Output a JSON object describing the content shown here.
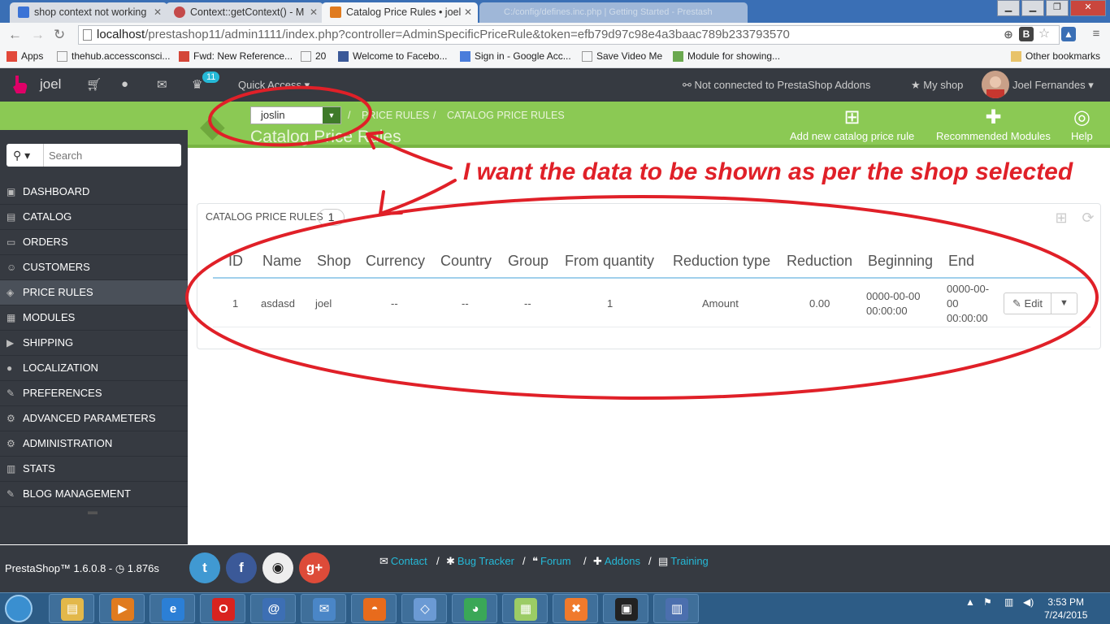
{
  "browser": {
    "tabs": [
      {
        "title": "shop context not working",
        "favicon_color": "#3b73d6",
        "active": false
      },
      {
        "title": "Context::getContext() - M",
        "favicon_color": "#c44a4a",
        "active": false
      },
      {
        "title": "Catalog Price Rules • joel",
        "favicon_color": "#e07b1f",
        "active": true
      }
    ],
    "ghost_tab": "C:/config/defines.inc.php | Getting Started - Prestash",
    "window_controls": {
      "minimize": "▁",
      "restore": "❐",
      "close": "✕"
    },
    "url_host": "localhost",
    "url_path": "/prestashop11/admin1111/index.php?controller=AdminSpecificPriceRule&token=efb79d97c98e4a3baac789b233793570",
    "bookmarks": [
      {
        "label": "Apps",
        "icon_color": "#e2483a"
      },
      {
        "label": "thehub.accessconsci...",
        "icon_color": "#ddd"
      },
      {
        "label": "Fwd: New Reference...",
        "icon_color": "#d44638"
      },
      {
        "label": "20",
        "icon_color": "#ddd"
      },
      {
        "label": "Welcome to Facebo...",
        "icon_color": "#3b5998"
      },
      {
        "label": "Sign in - Google Acc...",
        "icon_color": "#4a7ddb"
      },
      {
        "label": "Save Video Me",
        "icon_color": "#ddd"
      },
      {
        "label": "Module for showing...",
        "icon_color": "#6aa84f"
      }
    ],
    "other_bookmarks": "Other bookmarks"
  },
  "header": {
    "shop_name": "joel",
    "notification_count": "11",
    "quick_access": "Quick Access ▾",
    "addons_status": "Not connected to PrestaShop Addons",
    "my_shop": "My shop",
    "user_name": "Joel Fernandes ▾"
  },
  "toolbar": {
    "shop_selected": "joslin",
    "breadcrumb_1": "Price rules",
    "breadcrumb_2": "Catalog price rules",
    "page_title": "Catalog Price Rules",
    "add_new": "Add new catalog price rule",
    "recommended": "Recommended Modules",
    "help": "Help"
  },
  "sidebar": {
    "search_placeholder": "Search",
    "items": [
      {
        "label": "Dashboard",
        "icon": "▣"
      },
      {
        "label": "Catalog",
        "icon": "▤"
      },
      {
        "label": "Orders",
        "icon": "▭"
      },
      {
        "label": "Customers",
        "icon": "☺"
      },
      {
        "label": "Price Rules",
        "icon": "◈"
      },
      {
        "label": "Modules",
        "icon": "▦"
      },
      {
        "label": "Shipping",
        "icon": "▶"
      },
      {
        "label": "Localization",
        "icon": "●"
      },
      {
        "label": "Preferences",
        "icon": "✎"
      },
      {
        "label": "Advanced Parameters",
        "icon": "⚙"
      },
      {
        "label": "Administration",
        "icon": "⚙"
      },
      {
        "label": "Stats",
        "icon": "▥"
      },
      {
        "label": "Blog Management",
        "icon": "✎"
      }
    ],
    "active_index": 4
  },
  "panel": {
    "title": "Catalog price rules",
    "count": "1",
    "columns": [
      "ID",
      "Name",
      "Shop",
      "Currency",
      "Country",
      "Group",
      "From quantity",
      "Reduction type",
      "Reduction",
      "Beginning",
      "End"
    ],
    "rows": [
      {
        "id": "1",
        "name": "asdasd",
        "shop": "joel",
        "currency": "--",
        "country": "--",
        "group": "--",
        "from_quantity": "1",
        "reduction_type": "Amount",
        "reduction": "0.00",
        "beginning_1": "0000-00-00",
        "beginning_2": "00:00:00",
        "end_1": "0000-00-",
        "end_2": "00",
        "end_3": "00:00:00"
      }
    ],
    "edit_label": "Edit"
  },
  "annotation": "I want the data to be shown as per the shop selected",
  "footer": {
    "version": "PrestaShop™ 1.6.0.8 - ◷ 1.876s",
    "links": [
      "Contact",
      "Bug Tracker",
      "Forum",
      "Addons",
      "Training"
    ],
    "social": [
      {
        "name": "twitter",
        "glyph": "t",
        "color": "#4099d2"
      },
      {
        "name": "facebook",
        "glyph": "f",
        "color": "#3b5998"
      },
      {
        "name": "github",
        "glyph": "◉",
        "color": "#eee"
      },
      {
        "name": "google-plus",
        "glyph": "g+",
        "color": "#dd4b39"
      }
    ]
  },
  "taskbar": {
    "apps": [
      {
        "glyph": "▤",
        "color": "#e3b84a"
      },
      {
        "glyph": "▶",
        "color": "#e07b1f"
      },
      {
        "glyph": "e",
        "color": "#2b7fd6"
      },
      {
        "glyph": "O",
        "color": "#d9231f"
      },
      {
        "glyph": "@",
        "color": "#3d6fb4"
      },
      {
        "glyph": "✉",
        "color": "#4a86c7"
      },
      {
        "glyph": "◓",
        "color": "#e86b1c"
      },
      {
        "glyph": "◇",
        "color": "#6b9ad4"
      },
      {
        "glyph": "◕",
        "color": "#3aa757"
      },
      {
        "glyph": "▦",
        "color": "#9ccc65"
      },
      {
        "glyph": "✖",
        "color": "#f07a2c"
      },
      {
        "glyph": "▣",
        "color": "#222"
      },
      {
        "glyph": "▥",
        "color": "#4b6fae"
      }
    ],
    "time": "3:53 PM",
    "date": "7/24/2015"
  }
}
